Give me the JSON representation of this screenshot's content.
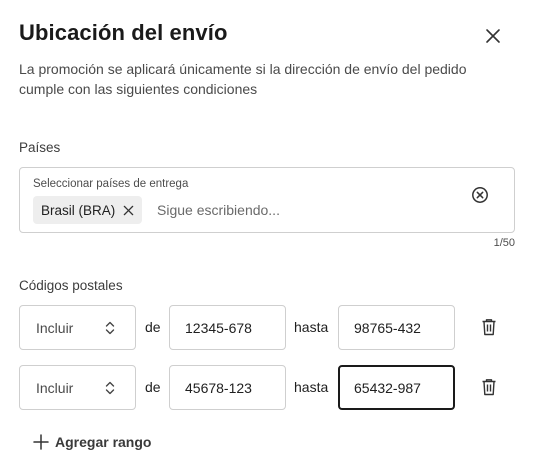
{
  "dialog": {
    "title": "Ubicación del envío",
    "description": "La promoción se aplicará únicamente si la dirección de envío del pedido cumple con las siguientes condiciones"
  },
  "countries": {
    "label": "Países",
    "inner_label": "Seleccionar países de entrega",
    "chips": [
      {
        "label": "Brasil (BRA)"
      }
    ],
    "placeholder": "Sigue escribiendo...",
    "counter": "1/50"
  },
  "postal_codes": {
    "label": "Códigos postales",
    "connector_from": "de",
    "connector_to": "hasta",
    "ranges": [
      {
        "mode": "Incluir",
        "from": "12345-678",
        "to": "98765-432"
      },
      {
        "mode": "Incluir",
        "from": "45678-123",
        "to": "65432-987"
      }
    ],
    "add_range_label": "Agregar rango"
  },
  "icons": {
    "close": "close-icon",
    "chip_remove": "close-small-icon",
    "clear": "clear-circle-icon",
    "select_chevron": "chevron-up-down-icon",
    "delete": "trash-icon",
    "add": "plus-icon"
  },
  "colors": {
    "text": "#1f1f1f",
    "border": "#cfcfcf",
    "chip_bg": "#eeeeee",
    "focus_border": "#1a1a1a"
  }
}
